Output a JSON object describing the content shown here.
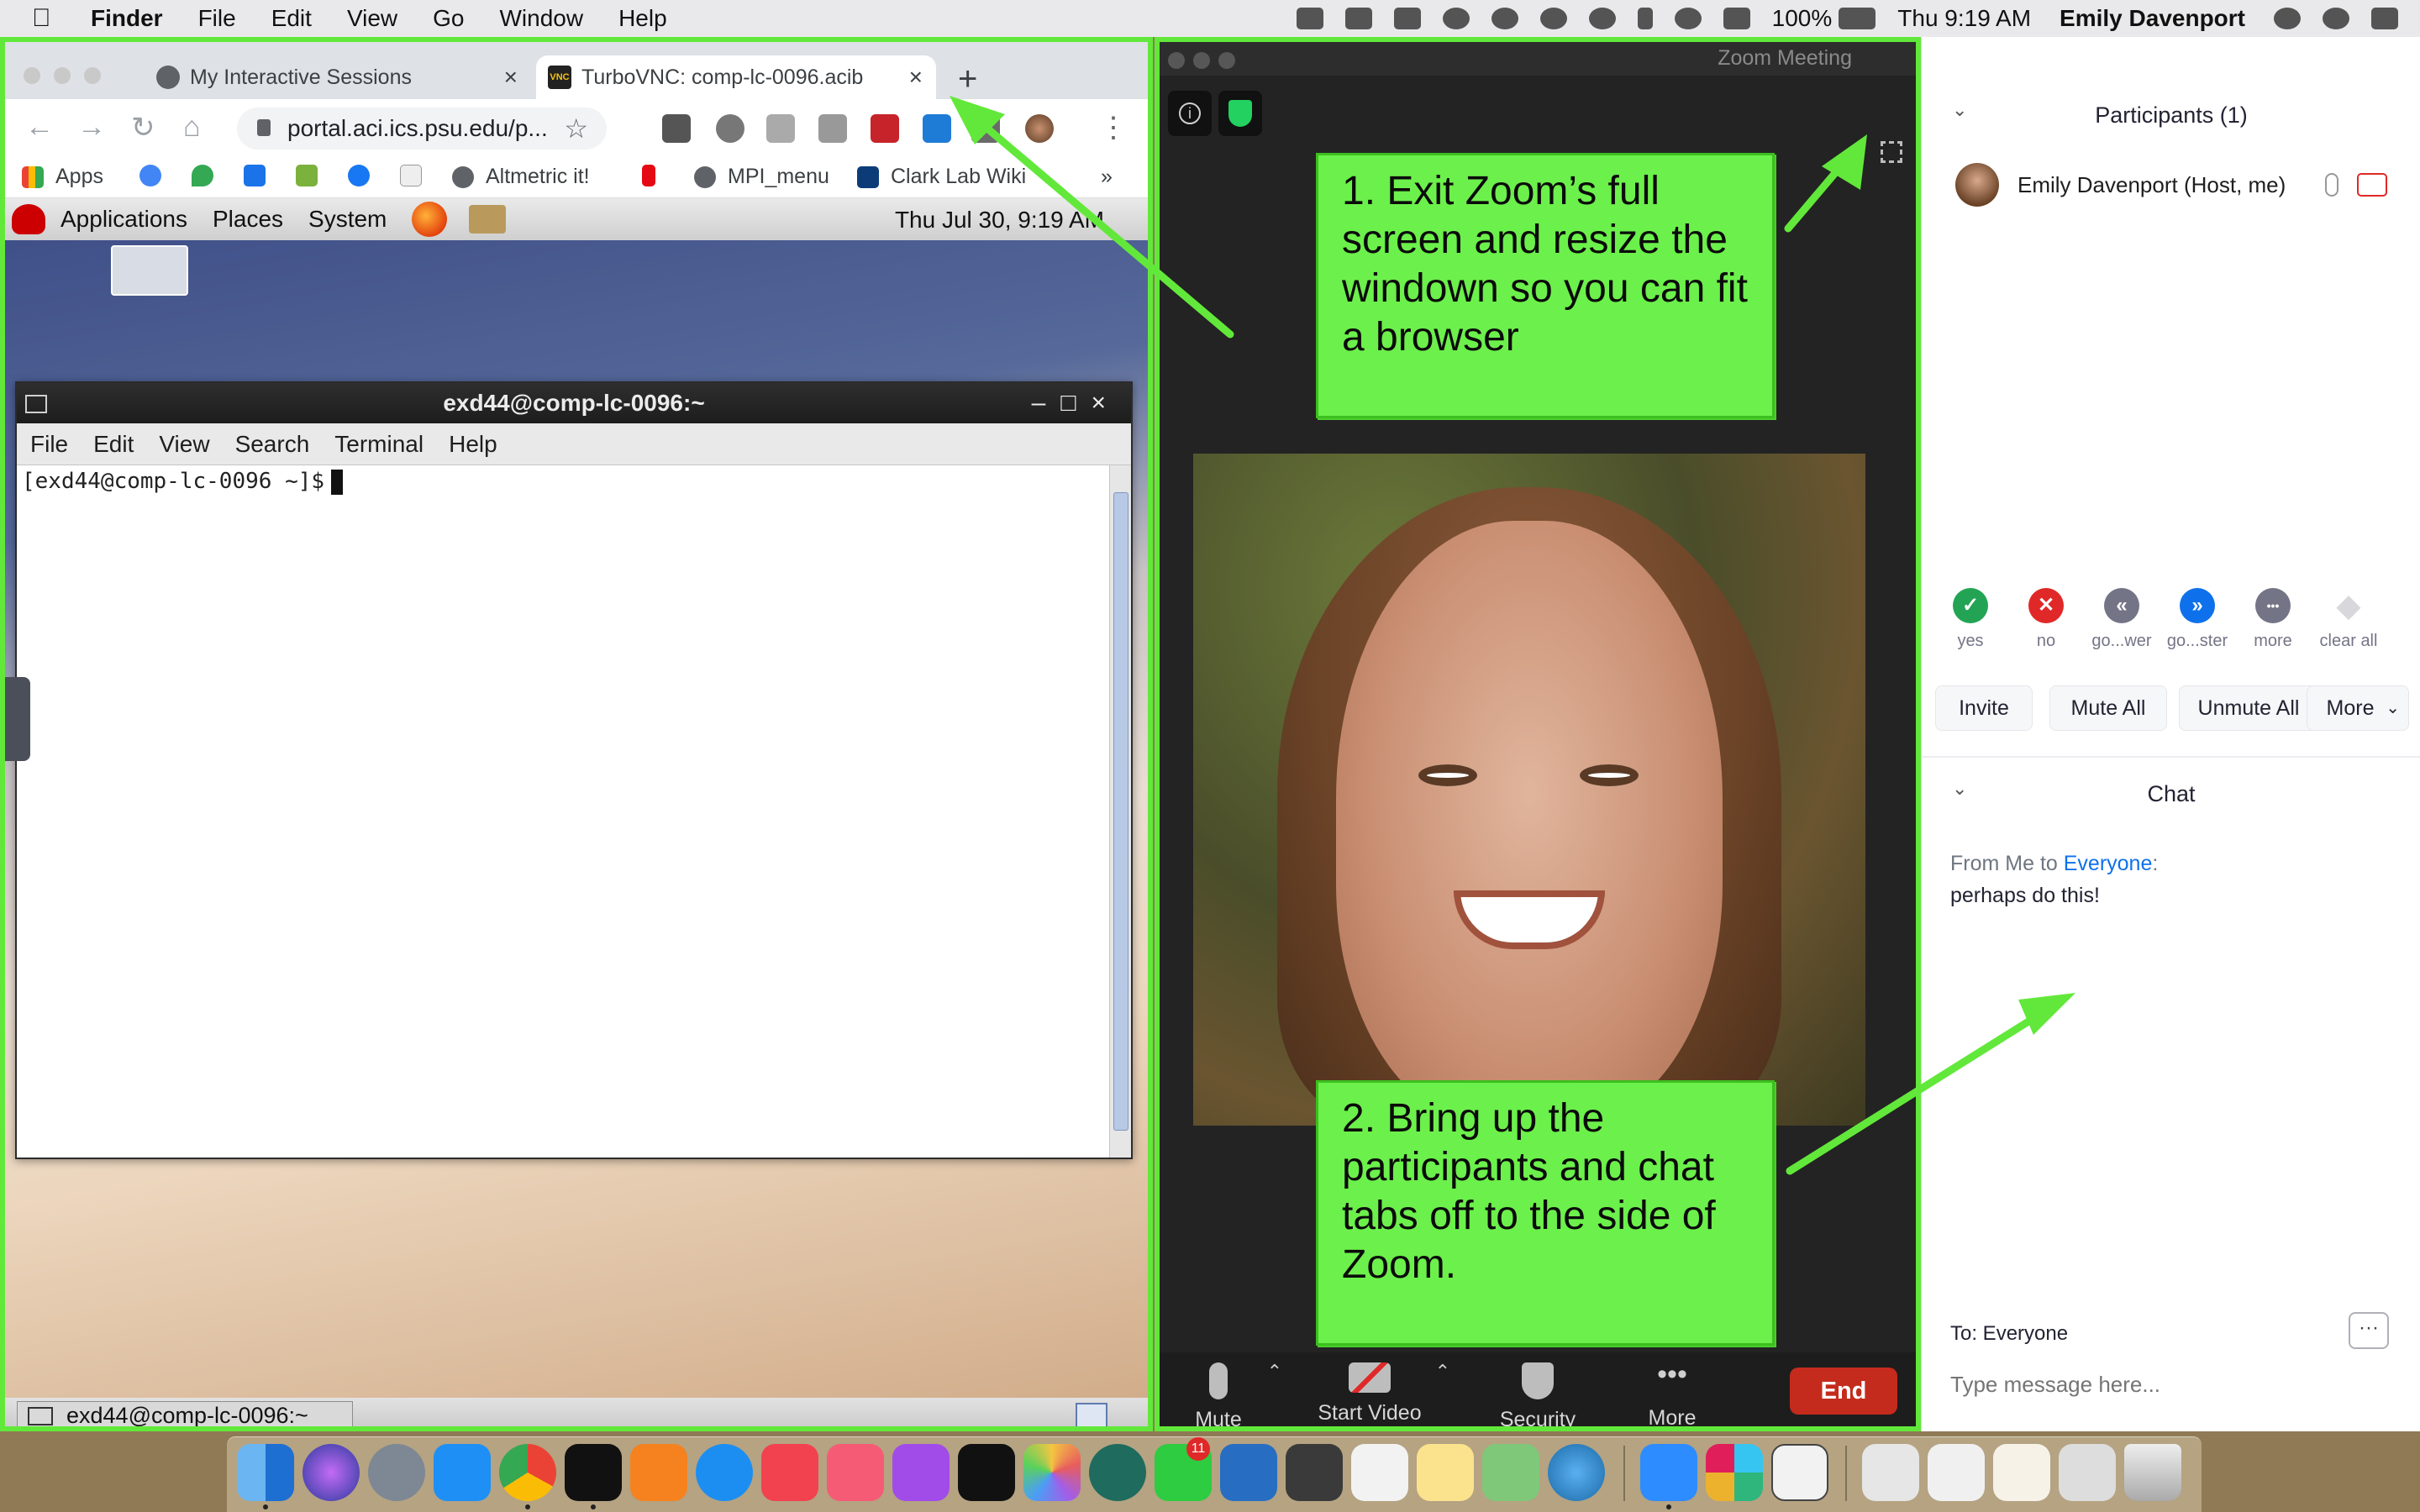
{
  "menubar": {
    "apple_icon": "apple-logo-icon",
    "app_name": "Finder",
    "menus": [
      "File",
      "Edit",
      "View",
      "Go",
      "Window",
      "Help"
    ],
    "battery": "100%",
    "datetime": "Thu 9:19 AM",
    "user": "Emily Davenport"
  },
  "browser": {
    "tabs": [
      {
        "title": "My Interactive Sessions",
        "icon": "globe-icon"
      },
      {
        "title": "TurboVNC: comp-lc-0096.acib",
        "icon": "vnc-icon"
      }
    ],
    "url": "portal.aci.ics.psu.edu/p...",
    "bookmarks": [
      "Apps",
      "Altmetric it!",
      "MPI_menu",
      "Clark Lab Wiki"
    ],
    "overflow": "»"
  },
  "gnome": {
    "menus": [
      "Applications",
      "Places",
      "System"
    ],
    "clock": "Thu Jul 30,  9:19 AM",
    "terminal_title": "exd44@comp-lc-0096:~",
    "terminal_menus": [
      "File",
      "Edit",
      "View",
      "Search",
      "Terminal",
      "Help"
    ],
    "prompt": "[exd44@comp-lc-0096 ~]$",
    "taskbar_item": "exd44@comp-lc-0096:~"
  },
  "zoom": {
    "window_title": "Zoom Meeting",
    "notes": [
      "1. Exit Zoom’s full screen and resize the windown so you can fit a browser",
      "2. Bring up the participants and chat tabs off to the side of Zoom."
    ],
    "controls": [
      "Mute",
      "Start Video",
      "Security",
      "More"
    ],
    "end_label": "End"
  },
  "panel": {
    "participants_title": "Participants (1)",
    "participant_name": "Emily Davenport (Host, me)",
    "reactions": [
      {
        "label": "yes",
        "glyph": "✓",
        "color": "#23a454"
      },
      {
        "label": "no",
        "glyph": "✕",
        "color": "#e02828"
      },
      {
        "label": "go...wer",
        "glyph": "«",
        "color": "#747487"
      },
      {
        "label": "go...ster",
        "glyph": "»",
        "color": "#0e71eb"
      },
      {
        "label": "more",
        "glyph": "•••",
        "color": "#747487"
      },
      {
        "label": "clear all",
        "glyph": "◆",
        "color": "#d8d8dc"
      }
    ],
    "buttons": [
      "Invite",
      "Mute All",
      "Unmute All",
      "More"
    ],
    "chat_title": "Chat",
    "chat_from_prefix": "From Me to ",
    "chat_from_target": "Everyone",
    "chat_from_suffix": ":",
    "chat_message": "perhaps do this!",
    "to_label": "To: Everyone",
    "input_placeholder": "Type message here...",
    "more_glyph": "···"
  },
  "dock": {
    "badge": "11"
  },
  "colors": {
    "highlight_green": "#62e83a",
    "note_green": "#6cf04b",
    "zoom_end_red": "#c42b1c",
    "zoom_blue": "#0e71eb"
  }
}
